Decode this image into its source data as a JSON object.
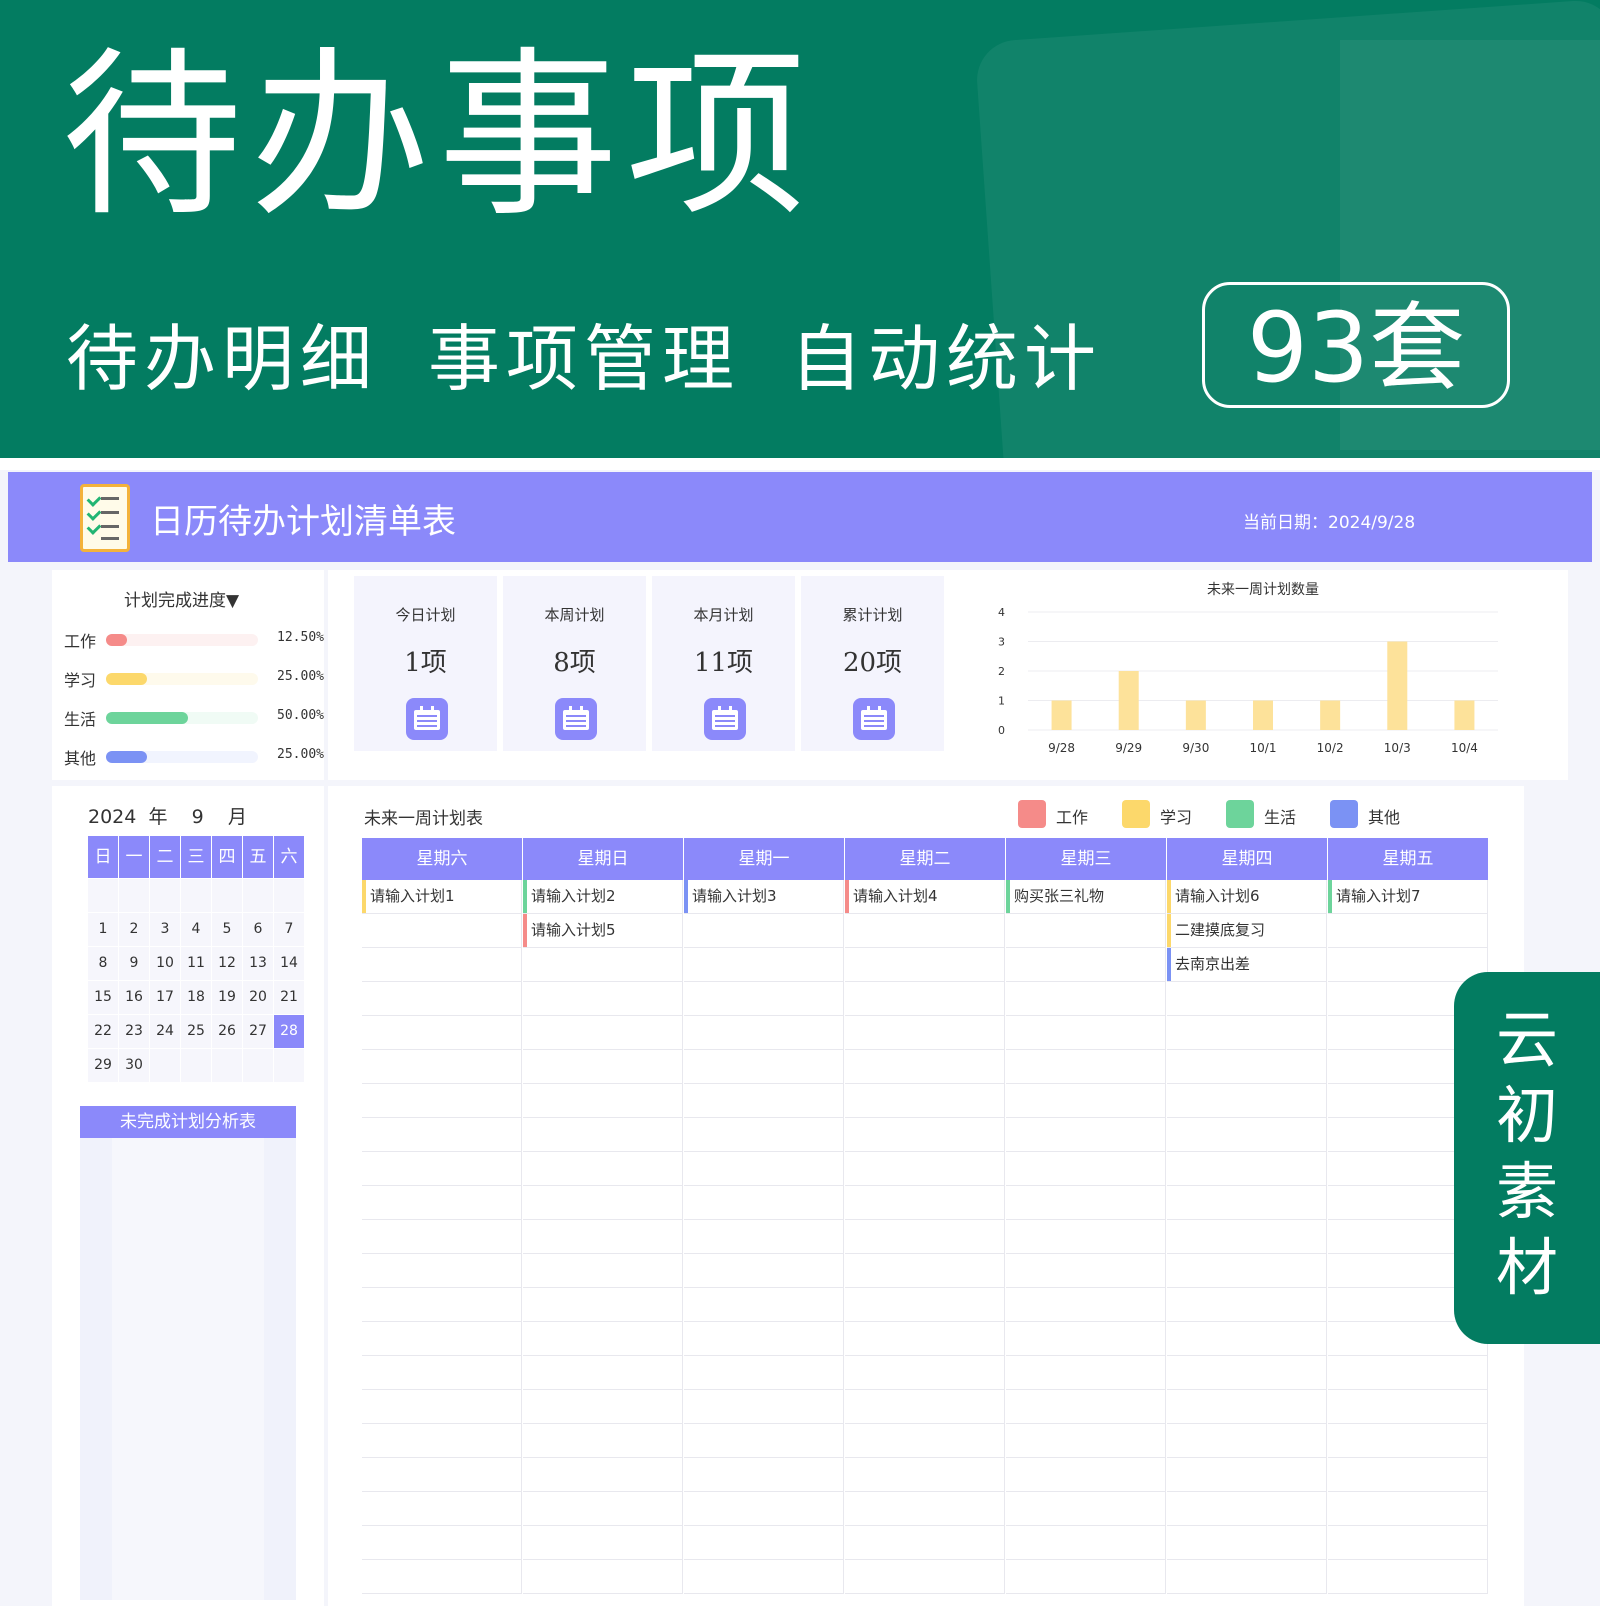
{
  "hero": {
    "title": "待办事项",
    "subtitle": [
      "待办明细",
      "事项管理",
      "自动统计"
    ],
    "badge": "93套"
  },
  "app": {
    "title": "日历待办计划清单表",
    "current_date_label": "当前日期：",
    "current_date": "2024/9/28"
  },
  "progress": {
    "title": "计划完成进度▼",
    "items": [
      {
        "label": "工作",
        "value": "12.50%",
        "fraction": 0.125,
        "color": "#f58b89",
        "track": "#fdf1f1"
      },
      {
        "label": "学习",
        "value": "25.00%",
        "fraction": 0.25,
        "color": "#fcd86b",
        "track": "#fefaec"
      },
      {
        "label": "生活",
        "value": "50.00%",
        "fraction": 0.5,
        "color": "#6dd49b",
        "track": "#f0fbf5"
      },
      {
        "label": "其他",
        "value": "25.00%",
        "fraction": 0.25,
        "color": "#7b92f4",
        "track": "#f1f4fe"
      }
    ]
  },
  "stats": [
    {
      "label": "今日计划",
      "value": "1项"
    },
    {
      "label": "本周计划",
      "value": "8项"
    },
    {
      "label": "本月计划",
      "value": "11项"
    },
    {
      "label": "累计计划",
      "value": "20项"
    }
  ],
  "chart_data": {
    "type": "bar",
    "title": "未来一周计划数量",
    "categories": [
      "9/28",
      "9/29",
      "9/30",
      "10/1",
      "10/2",
      "10/3",
      "10/4"
    ],
    "values": [
      1,
      2,
      1,
      1,
      1,
      3,
      1
    ],
    "ylim": [
      0,
      4
    ],
    "yticks": [
      "0",
      "1",
      "2",
      "3",
      "4"
    ],
    "grid": true,
    "color": "#fde29a"
  },
  "calendar": {
    "year": "2024",
    "year_unit": "年",
    "month": "9",
    "month_unit": "月",
    "weekdays": [
      "日",
      "一",
      "二",
      "三",
      "四",
      "五",
      "六"
    ],
    "days": [
      "",
      "",
      "",
      "",
      "",
      "",
      "",
      "1",
      "2",
      "3",
      "4",
      "5",
      "6",
      "7",
      "8",
      "9",
      "10",
      "11",
      "12",
      "13",
      "14",
      "15",
      "16",
      "17",
      "18",
      "19",
      "20",
      "21",
      "22",
      "23",
      "24",
      "25",
      "26",
      "27",
      "28",
      "29",
      "30",
      "",
      "",
      "",
      "",
      ""
    ],
    "today": "28"
  },
  "unfinished": {
    "title": "未完成计划分析表"
  },
  "week": {
    "title": "未来一周计划表",
    "legend": [
      {
        "label": "工作",
        "color": "#f58b89"
      },
      {
        "label": "学习",
        "color": "#fcd86b"
      },
      {
        "label": "生活",
        "color": "#6dd49b"
      },
      {
        "label": "其他",
        "color": "#7b92f4"
      }
    ],
    "days": [
      {
        "name": "星期六",
        "items": [
          {
            "text": "请输入计划1",
            "color": "#fcd86b"
          }
        ]
      },
      {
        "name": "星期日",
        "items": [
          {
            "text": "请输入计划2",
            "color": "#6dd49b"
          },
          {
            "text": "请输入计划5",
            "color": "#f58b89"
          }
        ]
      },
      {
        "name": "星期一",
        "items": [
          {
            "text": "请输入计划3",
            "color": "#7b92f4"
          }
        ]
      },
      {
        "name": "星期二",
        "items": [
          {
            "text": "请输入计划4",
            "color": "#f58b89"
          }
        ]
      },
      {
        "name": "星期三",
        "items": [
          {
            "text": "购买张三礼物",
            "color": "#6dd49b"
          }
        ]
      },
      {
        "name": "星期四",
        "items": [
          {
            "text": "请输入计划6",
            "color": "#fcd86b"
          },
          {
            "text": "二建摸底复习",
            "color": "#fcd86b"
          },
          {
            "text": "去南京出差",
            "color": "#7b92f4"
          }
        ]
      },
      {
        "name": "星期五",
        "items": [
          {
            "text": "请输入计划7",
            "color": "#6dd49b"
          }
        ]
      }
    ]
  },
  "corner": {
    "chars": [
      "云",
      "初",
      "素",
      "材"
    ]
  }
}
